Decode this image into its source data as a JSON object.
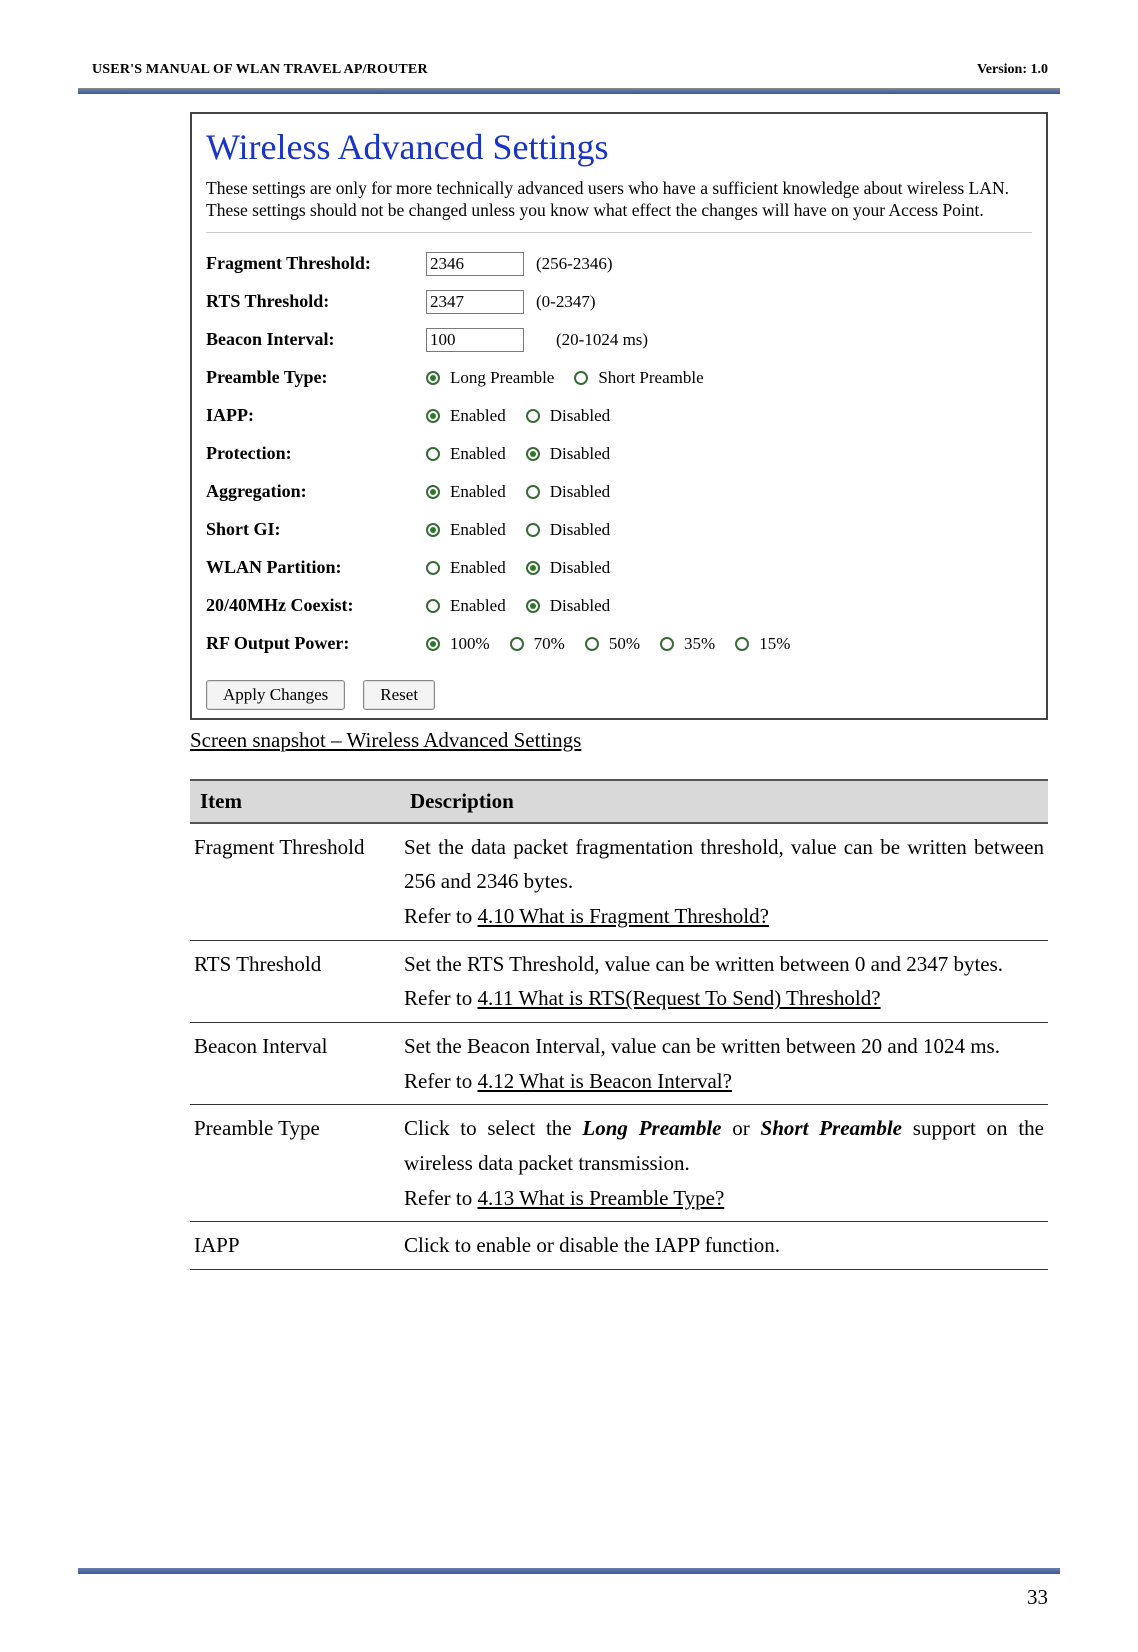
{
  "header": {
    "left": "USER'S MANUAL OF WLAN TRAVEL AP/ROUTER",
    "right": "Version: 1.0"
  },
  "panel": {
    "title": "Wireless Advanced Settings",
    "description": "These settings are only for more technically advanced users who have a sufficient knowledge about wireless LAN. These settings should not be changed unless you know what effect the changes will have on your Access Point.",
    "rows": {
      "fragment": {
        "label": "Fragment Threshold:",
        "value": "2346",
        "range": "(256-2346)"
      },
      "rts": {
        "label": "RTS Threshold:",
        "value": "2347",
        "range": "(0-2347)"
      },
      "beacon": {
        "label": "Beacon Interval:",
        "value": "100",
        "range": "(20-1024 ms)"
      },
      "preamble": {
        "label": "Preamble Type:",
        "opt1": "Long Preamble",
        "opt2": "Short Preamble"
      },
      "iapp": {
        "label": "IAPP:",
        "opt1": "Enabled",
        "opt2": "Disabled"
      },
      "protection": {
        "label": "Protection:",
        "opt1": "Enabled",
        "opt2": "Disabled"
      },
      "aggregation": {
        "label": "Aggregation:",
        "opt1": "Enabled",
        "opt2": "Disabled"
      },
      "shortgi": {
        "label": "Short GI:",
        "opt1": "Enabled",
        "opt2": "Disabled"
      },
      "wlanpart": {
        "label": "WLAN Partition:",
        "opt1": "Enabled",
        "opt2": "Disabled"
      },
      "coexist": {
        "label": "20/40MHz Coexist:",
        "opt1": "Enabled",
        "opt2": "Disabled"
      },
      "rfpower": {
        "label": "RF Output Power:",
        "o1": "100%",
        "o2": "70%",
        "o3": "50%",
        "o4": "35%",
        "o5": "15%"
      }
    },
    "buttons": {
      "apply": "Apply Changes",
      "reset": "Reset"
    }
  },
  "caption": "Screen snapshot – Wireless Advanced Settings",
  "table": {
    "head": {
      "c1": "Item",
      "c2": "Description"
    },
    "rows": [
      {
        "item": "Fragment Threshold",
        "desc_a": "Set the data packet fragmentation threshold, value can be written between 256 and 2346 bytes.",
        "desc_b": "Refer to ",
        "link": "4.10 What is Fragment Threshold?"
      },
      {
        "item": "RTS Threshold",
        "desc_a": "Set the RTS Threshold, value can be written between 0 and 2347 bytes.",
        "desc_b": "Refer to ",
        "link": "4.11 What is RTS(Request To Send) Threshold?"
      },
      {
        "item": "Beacon Interval",
        "desc_a": "Set the Beacon Interval, value can be written between 20 and 1024 ms.",
        "desc_b": "Refer to ",
        "link": "4.12 What is Beacon Interval?"
      },
      {
        "item": "Preamble Type",
        "desc_pre": "Click to select the ",
        "em1": "Long Preamble",
        "mid": " or ",
        "em2": "Short Preamble",
        "post": " support on the wireless data packet transmission.",
        "desc_b": "Refer to ",
        "link": "4.13 What is Preamble Type?"
      },
      {
        "item": "IAPP",
        "desc_a": "Click to enable or disable the IAPP function."
      }
    ]
  },
  "page_number": "33"
}
